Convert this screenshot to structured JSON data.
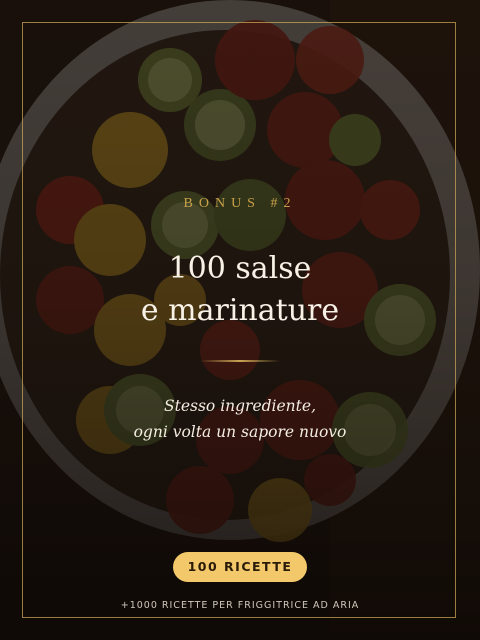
{
  "bonus_label": "BONUS #2",
  "title": {
    "line1": "100 salse",
    "line2": "e marinature"
  },
  "subtitle": {
    "line1": "Stesso ingrediente,",
    "line2": "ogni volta un sapore nuovo"
  },
  "badge_label": "100 RICETTE",
  "footer_text": "+1000 RICETTE PER FRIGGITRICE AD ARIA",
  "colors": {
    "accent_gold": "#c9a454",
    "badge_fill": "#f2c86a",
    "title_text": "#f7f1e6"
  },
  "background_image": "roasted-vegetables-bowl-photo"
}
